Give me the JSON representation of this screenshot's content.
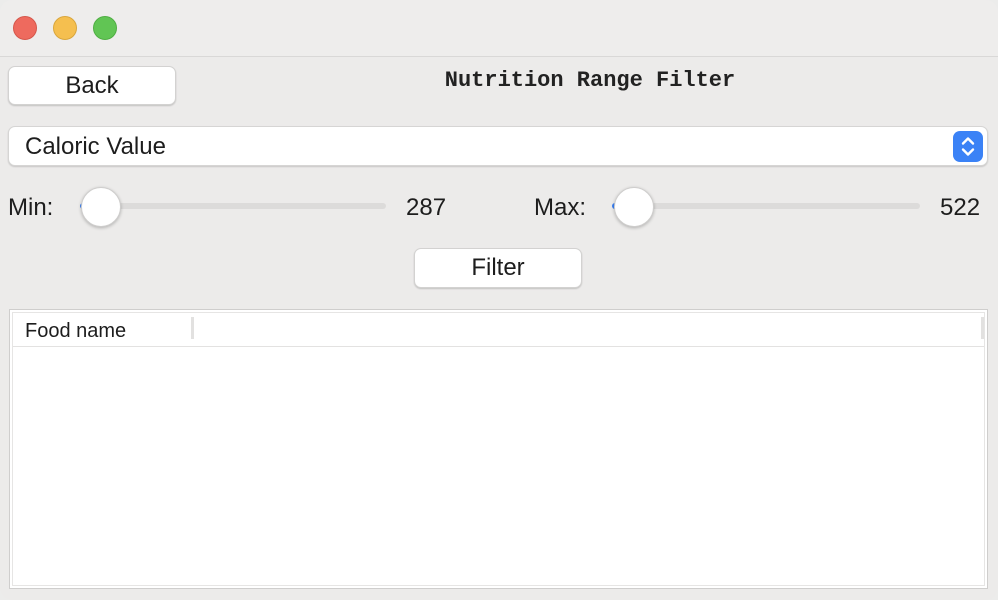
{
  "window": {
    "title": "Nutrition Range Filter",
    "traffic_lights": [
      "close",
      "minimize",
      "zoom"
    ]
  },
  "toolbar": {
    "back_label": "Back",
    "filter_label": "Filter"
  },
  "nutrient_select": {
    "selected": "Caloric Value"
  },
  "min_slider": {
    "label": "Min:",
    "value": "287",
    "fraction": 0.07
  },
  "max_slider": {
    "label": "Max:",
    "value": "522",
    "fraction": 0.07
  },
  "results_table": {
    "columns": [
      "Food name"
    ],
    "rows": []
  },
  "colors": {
    "accent": "#3b82f6",
    "traffic_close": "#ee6a5e",
    "traffic_min": "#f5bf4f",
    "traffic_max": "#61c554",
    "window_bg": "#ecebea"
  }
}
